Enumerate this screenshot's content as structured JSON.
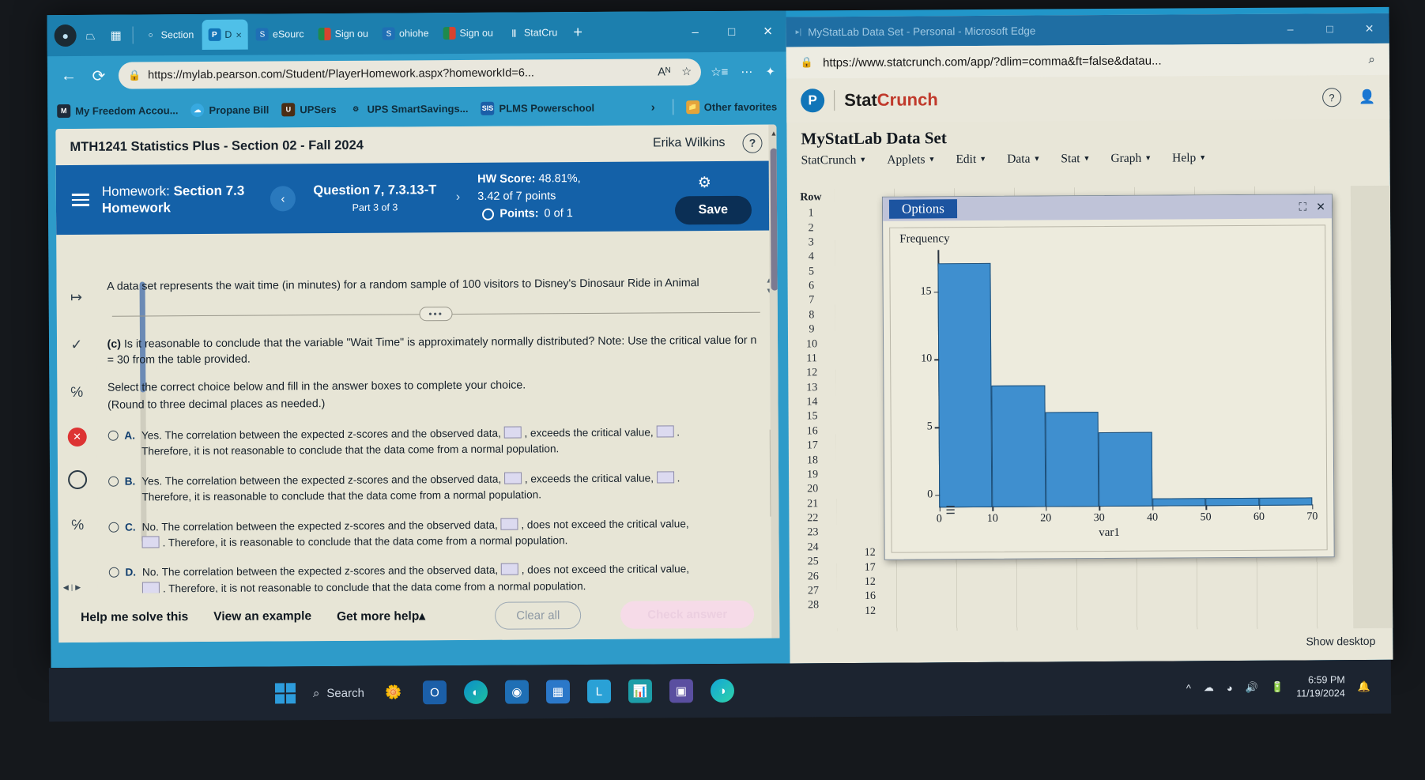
{
  "browser_left": {
    "tabs": [
      {
        "label": "Section",
        "favicon": "ring-icon",
        "active": false
      },
      {
        "label": "D",
        "favicon": "pearson-icon",
        "active": true,
        "close": "×"
      },
      {
        "label": "eSourc",
        "favicon": "s-icon",
        "active": false
      },
      {
        "label": "Sign ou",
        "favicon": "green-red-icon",
        "active": false
      },
      {
        "label": "ohiohe",
        "favicon": "s-icon",
        "active": false
      },
      {
        "label": "Sign ou",
        "favicon": "green-red-icon",
        "active": false
      },
      {
        "label": "StatCru",
        "favicon": "bars-icon",
        "active": false
      }
    ],
    "new_tab": "+",
    "window_controls": [
      "–",
      "□",
      "✕"
    ],
    "url": "https://mylab.pearson.com/Student/PlayerHomework.aspx?homeworkId=6...",
    "url_read_aloud": "Aᴺ",
    "url_favorite": "☆",
    "back": "←",
    "refresh": "⟳",
    "favorites": [
      {
        "label": "My Freedom Accou...",
        "icon": "m-icon"
      },
      {
        "label": "Propane Bill",
        "icon": "cloud-icon"
      },
      {
        "label": "UPSers",
        "icon": "ups-icon"
      },
      {
        "label": "UPS SmartSavings...",
        "icon": "gear-icon"
      },
      {
        "label": "PLMS Powerschool",
        "icon": "sis-icon"
      }
    ],
    "favorites_overflow": "›",
    "other_favorites": "Other favorites"
  },
  "mylab": {
    "course_title": "MTH1241 Statistics Plus - Section 02 - Fall 2024",
    "user_name": "Erika Wilkins",
    "help_icon": "?",
    "homework_label": "Homework:",
    "homework_name": "Section 7.3 Homework",
    "prev_arrow": "‹",
    "next_arrow": "›",
    "question_title": "Question 7, 7.3.13-T",
    "question_part": "Part 3 of 3",
    "hw_score_label": "HW Score:",
    "hw_score_value": "48.81%,",
    "hw_points": "3.42 of 7 points",
    "points_label": "Points:",
    "points_value": "0 of 1",
    "gear_icon": "⚙",
    "save_label": "Save",
    "question_intro": "A data set represents the wait time (in minutes) for a random sample of 100 visitors to Disney's Dinosaur Ride in Animal",
    "divider_dots": "•••",
    "part_c": "(c)",
    "part_c_text": "Is it reasonable to conclude that the variable \"Wait Time\" is approximately normally distributed? Note: Use the critical value for n = 30 from the table provided.",
    "instruction": "Select the correct choice below and fill in the answer boxes to complete your choice.",
    "rounding_note": "(Round to three decimal places as needed.)",
    "choices": [
      {
        "letter": "A.",
        "part1": "Yes. The correlation between the expected z-scores and the observed data,",
        "part2": ", exceeds the critical value,",
        "part3": ".",
        "line2": "Therefore, it is not reasonable to conclude that the data come from a normal population.",
        "box_count": 2
      },
      {
        "letter": "B.",
        "part1": "Yes. The correlation between the expected z-scores and the observed data,",
        "part2": ", exceeds the critical value,",
        "part3": ".",
        "line2": "Therefore, it is reasonable to conclude that the data come from a normal population.",
        "box_count": 2
      },
      {
        "letter": "C.",
        "part1": "No. The correlation between the expected z-scores and the observed data,",
        "part2": ", does not exceed the critical value,",
        "part3": ".",
        "line2": "Therefore, it is reasonable to conclude that the data come from a normal population.",
        "box_count": 2
      },
      {
        "letter": "D.",
        "part1": "No. The correlation between the expected z-scores and the observed data,",
        "part2": ", does not exceed the critical value,",
        "part3": ".",
        "line2": "Therefore, it is not reasonable to conclude that the data come from a normal population.",
        "box_count": 2
      }
    ],
    "footer": {
      "help_me": "Help me solve this",
      "view_example": "View an example",
      "get_more_help": "Get more help",
      "get_more_help_caret": "▴",
      "clear_all": "Clear all",
      "check_answer": "Check answer"
    }
  },
  "browser_right": {
    "window_title": "MyStatLab Data Set - Personal - Microsoft Edge",
    "window_controls": [
      "–",
      "□",
      "✕"
    ],
    "url": "https://www.statcrunch.com/app/?dlim=comma&ft=false&datau...",
    "search_icon": "⌕"
  },
  "statcrunch": {
    "brand_stat": "Stat",
    "brand_crunch": "Crunch",
    "help_icon": "?",
    "user_icon": "ᴘ",
    "dataset_title": "MyStatLab Data Set",
    "menu": [
      "StatCrunch",
      "Applets",
      "Edit",
      "Data",
      "Stat",
      "Graph",
      "Help"
    ],
    "row_header": "Row",
    "row_numbers": [
      1,
      2,
      3,
      4,
      5,
      6,
      7,
      8,
      9,
      10,
      11,
      12,
      13,
      14,
      15,
      16,
      17,
      18,
      19,
      20,
      21,
      22,
      23,
      24,
      25,
      26,
      27,
      28
    ],
    "visible_values": [
      "12",
      "17",
      "12",
      "16",
      "12"
    ],
    "options_label": "Options",
    "window_expand": "⛶",
    "window_close": "✕",
    "show_desktop": "Show desktop"
  },
  "chart_data": {
    "type": "bar",
    "title": "",
    "ylabel": "Frequency",
    "xlabel": "var1",
    "bin_edges": [
      0,
      10,
      20,
      30,
      40,
      50,
      60,
      70
    ],
    "categories": [
      "0-10",
      "10-20",
      "20-30",
      "30-40",
      "40-50",
      "50-60",
      "60-70"
    ],
    "values": [
      18,
      9,
      7,
      5.5,
      0.6,
      0.6,
      0.6
    ],
    "xticks": [
      0,
      10,
      20,
      30,
      40,
      50,
      60,
      70
    ],
    "yticks": [
      0,
      5,
      10,
      15
    ],
    "ylim": [
      0,
      19
    ],
    "xlim": [
      0,
      70
    ],
    "bar_color": "#3f8fcf",
    "bar_edge_color": "#1d4f79",
    "grid": false,
    "legend": false
  },
  "taskbar": {
    "start": "windows-icon",
    "search_label": "Search",
    "search_icon": "⌕",
    "apps": [
      "flower-icon",
      "outlook-icon",
      "edge-icon",
      "teams-icon",
      "grid-icon",
      "L-icon",
      "chart-icon",
      "window-icon",
      "edge2-icon"
    ],
    "tray_caret": "^",
    "tray_cloud": "☁",
    "tray_wifi": "◰",
    "tray_volume": "◁)",
    "tray_battery": "▬",
    "time": "6:59 PM",
    "date": "11/19/2024",
    "bell": "ὑ4"
  }
}
